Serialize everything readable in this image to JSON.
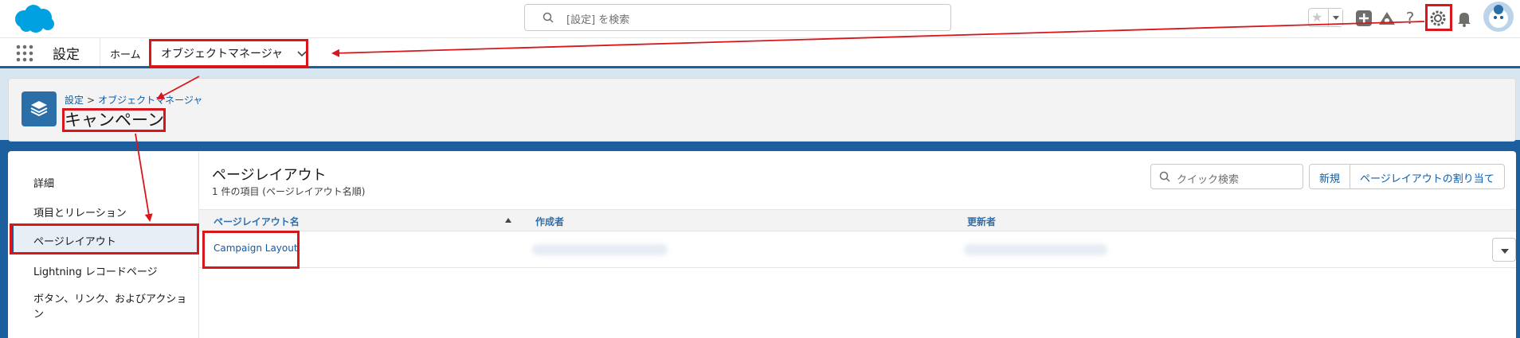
{
  "header": {
    "search_placeholder": "[設定] を検索",
    "icons": [
      "salesforce-logo",
      "search-icon",
      "star-icon",
      "add-icon",
      "trailhead-icon",
      "help-icon",
      "gear-icon",
      "bell-icon",
      "avatar"
    ]
  },
  "nav": {
    "app_name": "設定",
    "home": "ホーム",
    "object_manager": "オブジェクトマネージャ"
  },
  "object_header": {
    "breadcrumb_setup": "設定",
    "breadcrumb_sep": ">",
    "breadcrumb_om": "オブジェクトマネージャ",
    "title": "キャンペーン"
  },
  "left_nav": {
    "items": [
      "詳細",
      "項目とリレーション",
      "ページレイアウト",
      "Lightning レコードページ",
      "ボタン、リンク、およびアクション"
    ],
    "active_index": 2
  },
  "main": {
    "title": "ページレイアウト",
    "subtitle": "1 件の項目 (ページレイアウト名順)",
    "quick_search_placeholder": "クイック検索",
    "new_button": "新規",
    "assign_button": "ページレイアウトの割り当て",
    "columns": [
      "ページレイアウト名",
      "作成者",
      "更新者"
    ],
    "rows": [
      {
        "name": "Campaign Layout"
      }
    ]
  },
  "colors": {
    "brand_blue": "#1b5f9e",
    "link": "#0b5cab",
    "highlight_red": "#d8161b"
  }
}
